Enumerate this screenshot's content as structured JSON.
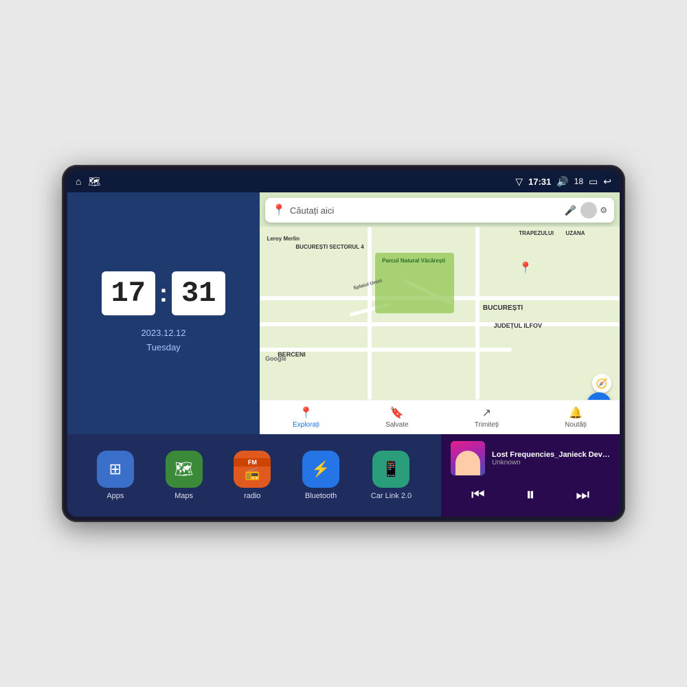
{
  "device": {
    "status_bar": {
      "signal_icon": "▽",
      "time": "17:31",
      "volume_icon": "🔊",
      "battery_level": "18",
      "battery_icon": "🔋",
      "back_icon": "↩"
    },
    "home_icon": "⌂",
    "maps_icon": "🗺"
  },
  "clock": {
    "hour": "17",
    "minute": "31",
    "date": "2023.12.12",
    "day": "Tuesday"
  },
  "map": {
    "search_placeholder": "Căutați aici",
    "labels": {
      "parcul": "Parcul Natural Văcărești",
      "leroy": "Leroy Merlin",
      "bucuresti": "BUCUREȘTI",
      "bucuresti_sector": "BUCUREȘTI\nSECTORUL 4",
      "ilfov": "JUDEȚUL ILFOV",
      "trapezului": "TRAPEZULUI",
      "uzana": "UZANA",
      "berceni": "BERCENI",
      "splaiul": "Splaiul Unirii"
    },
    "nav_items": [
      {
        "icon": "📍",
        "label": "Explorați",
        "active": true
      },
      {
        "icon": "🔖",
        "label": "Salvate",
        "active": false
      },
      {
        "icon": "↗",
        "label": "Trimiteți",
        "active": false
      },
      {
        "icon": "🔔",
        "label": "Noutăți",
        "active": false
      }
    ]
  },
  "apps": [
    {
      "id": "apps",
      "label": "Apps",
      "icon": "⊞",
      "class": "icon-apps"
    },
    {
      "id": "maps",
      "label": "Maps",
      "icon": "🗺",
      "class": "icon-maps"
    },
    {
      "id": "radio",
      "label": "radio",
      "icon": "📻",
      "class": "icon-radio"
    },
    {
      "id": "bluetooth",
      "label": "Bluetooth",
      "icon": "⚡",
      "class": "icon-bluetooth"
    },
    {
      "id": "carlink",
      "label": "Car Link 2.0",
      "icon": "📱",
      "class": "icon-carlink"
    }
  ],
  "music": {
    "title": "Lost Frequencies_Janieck Devy-...",
    "artist": "Unknown",
    "prev_icon": "⏮",
    "play_icon": "⏸",
    "next_icon": "⏭"
  }
}
